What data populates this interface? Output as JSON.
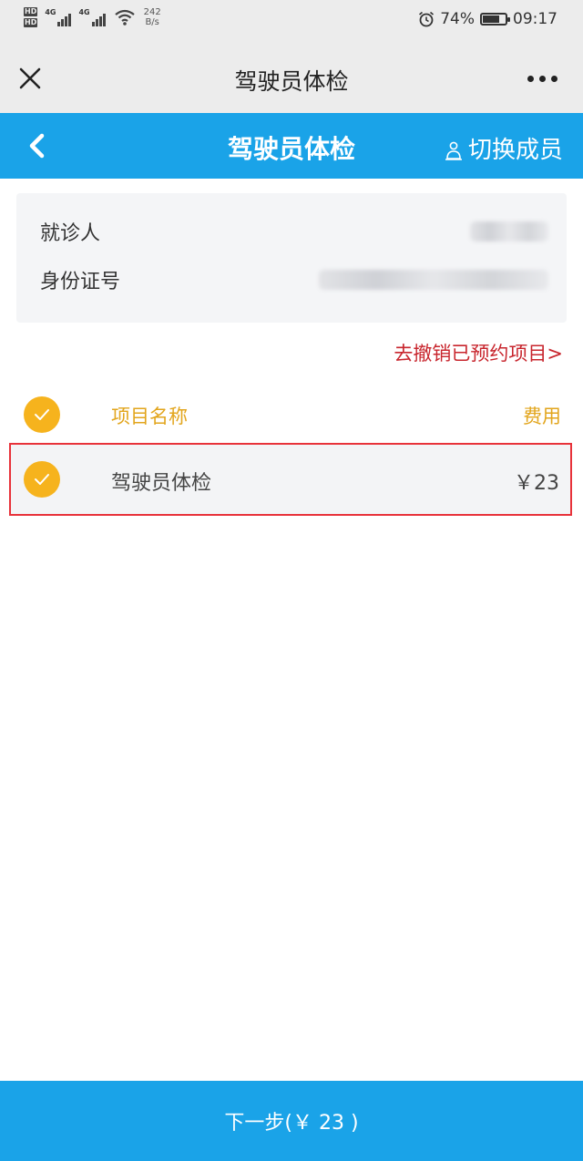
{
  "status_bar": {
    "hd_1": "HD",
    "hd_2": "HD",
    "net_1": "4G",
    "net_2": "4G",
    "speed_value": "242",
    "speed_unit": "B/s",
    "battery": "74%",
    "time": "09:17"
  },
  "title_bar": {
    "title": "驾驶员体检"
  },
  "app_header": {
    "title": "驾驶员体检",
    "switch_member_label": "切换成员"
  },
  "patient_info": {
    "patient_label": "就诊人",
    "id_label": "身份证号"
  },
  "cancel_link": "去撤销已预约项目>",
  "items_header": {
    "name_col": "项目名称",
    "fee_col": "费用"
  },
  "items": [
    {
      "name": "驾驶员体检",
      "price": "￥23",
      "selected": true
    }
  ],
  "next_button": "下一步(￥ 23 )",
  "colors": {
    "primary_blue": "#1aa3e8",
    "accent_orange": "#f6b31d",
    "header_text_orange": "#e2a51c",
    "cancel_red": "#c8252d",
    "highlight_border": "#e8323a"
  },
  "icons": {
    "close": "close-icon",
    "more": "more-icon",
    "back": "chevron-left-icon",
    "switch": "person-switch-icon",
    "check": "check-icon"
  }
}
